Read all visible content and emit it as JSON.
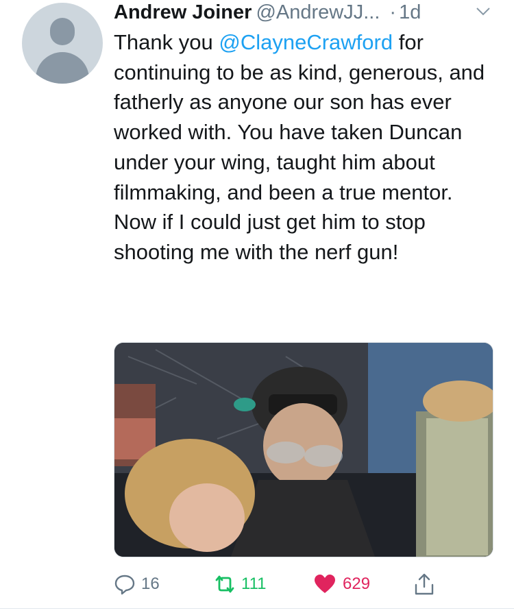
{
  "tweet": {
    "author_name": "Andrew Joiner",
    "handle": "@AndrewJJ...",
    "separator": "·",
    "time": "1d",
    "text_before": "Thank you ",
    "mention": "@ClayneCrawford",
    "text_after": " for continuing to be as kind, generous, and fatherly as anyone our son has ever worked with. You have taken Duncan under your wing, taught him about filmmaking, and been a true mentor. Now if I could just get him to stop shooting me with the nerf gun!"
  },
  "icons": {
    "avatar": "default-profile-avatar",
    "caret": "chevron-down-icon",
    "reply": "reply-bubble-icon",
    "retweet": "retweet-icon",
    "like": "heart-icon",
    "share": "share-icon"
  },
  "actions": {
    "reply_count": "16",
    "retweet_count": "111",
    "like_count": "629"
  },
  "colors": {
    "link": "#1da1f2",
    "retweet": "#17bf63",
    "like": "#e0245e",
    "muted": "#657786"
  }
}
